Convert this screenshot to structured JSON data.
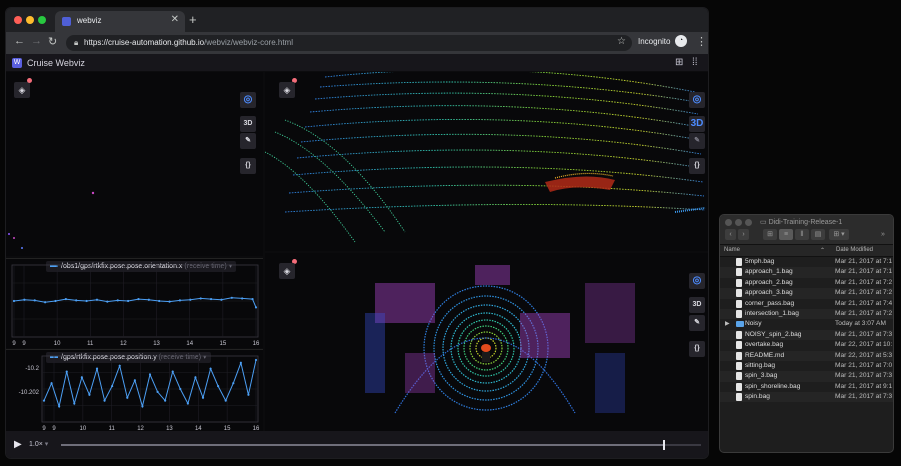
{
  "browser": {
    "tab_title": "webviz",
    "url_host": "https://cruise-automation.github.io",
    "url_path": "/webviz/webviz-core.html",
    "incognito_label": "Incognito",
    "traffic_colors": [
      "#ff5f57",
      "#febc2e",
      "#28c840"
    ]
  },
  "app": {
    "title": "Cruise Webviz",
    "toolbar_3d_label": "3D",
    "braces_label": "{}"
  },
  "plot_orientation": {
    "topic": "/obs1/gps/rtkfix.pose.pose.orientation.x",
    "suffix": "(receive time)",
    "x_ticks": [
      "9",
      "9",
      "10",
      "11",
      "12",
      "13",
      "14",
      "15",
      "16"
    ],
    "color": "#4c9ff4",
    "chart_data": {
      "type": "line",
      "x": [
        9,
        9.3,
        9.6,
        9.9,
        10.2,
        10.5,
        10.8,
        11.1,
        11.4,
        11.7,
        12.0,
        12.3,
        12.6,
        12.9,
        13.2,
        13.5,
        13.8,
        14.1,
        14.4,
        14.7,
        15.0,
        15.3,
        15.6,
        15.9,
        16
      ],
      "y": [
        0.5,
        0.52,
        0.51,
        0.48,
        0.5,
        0.53,
        0.51,
        0.5,
        0.52,
        0.49,
        0.51,
        0.5,
        0.53,
        0.52,
        0.5,
        0.49,
        0.51,
        0.52,
        0.54,
        0.53,
        0.52,
        0.55,
        0.54,
        0.53,
        0.4
      ]
    }
  },
  "plot_position": {
    "topic": "/gps/rtkfix.pose.pose.position.y",
    "suffix": "(receive time)",
    "y_ticks": [
      "-10.2",
      "-10.202"
    ],
    "x_ticks": [
      "9",
      "9",
      "10",
      "11",
      "12",
      "13",
      "14",
      "15",
      "16"
    ],
    "color": "#4c9ff4",
    "chart_data": {
      "type": "line",
      "x": [
        9,
        9.25,
        9.5,
        9.75,
        10.0,
        10.25,
        10.5,
        10.75,
        11.0,
        11.25,
        11.5,
        11.75,
        12.0,
        12.25,
        12.5,
        12.75,
        13.0,
        13.25,
        13.5,
        13.75,
        14.0,
        14.25,
        14.5,
        14.75,
        15.0,
        15.25,
        15.5,
        15.75,
        16
      ],
      "y": [
        0.3,
        0.6,
        0.2,
        0.8,
        0.25,
        0.7,
        0.4,
        0.85,
        0.3,
        0.55,
        0.9,
        0.35,
        0.65,
        0.2,
        0.75,
        0.45,
        0.3,
        0.8,
        0.5,
        0.25,
        0.7,
        0.35,
        0.85,
        0.55,
        0.3,
        0.6,
        0.95,
        0.4,
        1.0
      ]
    }
  },
  "playback": {
    "speed": "1.0×",
    "progress": 0.94
  },
  "finder": {
    "title": "Didi-Training-Release-1",
    "col_name": "Name",
    "col_date": "Date Modified",
    "files": [
      {
        "name": "5mph.bag",
        "date": "Mar 21, 2017 at 7:1",
        "type": "file"
      },
      {
        "name": "approach_1.bag",
        "date": "Mar 21, 2017 at 7:1",
        "type": "file"
      },
      {
        "name": "approach_2.bag",
        "date": "Mar 21, 2017 at 7:2",
        "type": "file"
      },
      {
        "name": "approach_3.bag",
        "date": "Mar 21, 2017 at 7:2",
        "type": "file"
      },
      {
        "name": "corner_pass.bag",
        "date": "Mar 21, 2017 at 7:4",
        "type": "file"
      },
      {
        "name": "intersection_1.bag",
        "date": "Mar 21, 2017 at 7:2",
        "type": "file"
      },
      {
        "name": "Noisy",
        "date": "Today at 3:07 AM",
        "type": "folder"
      },
      {
        "name": "NOISY_spin_2.bag",
        "date": "Mar 21, 2017 at 7:3",
        "type": "file"
      },
      {
        "name": "overtake.bag",
        "date": "Mar 22, 2017 at 10:",
        "type": "file"
      },
      {
        "name": "README.md",
        "date": "Mar 22, 2017 at 5:3",
        "type": "file"
      },
      {
        "name": "sitting.bag",
        "date": "Mar 21, 2017 at 7:0",
        "type": "file"
      },
      {
        "name": "spin_3.bag",
        "date": "Mar 21, 2017 at 7:3",
        "type": "file"
      },
      {
        "name": "spin_shoreline.bag",
        "date": "Mar 21, 2017 at 9:1",
        "type": "file"
      },
      {
        "name": "spin.bag",
        "date": "Mar 21, 2017 at 7:3",
        "type": "file"
      }
    ]
  }
}
